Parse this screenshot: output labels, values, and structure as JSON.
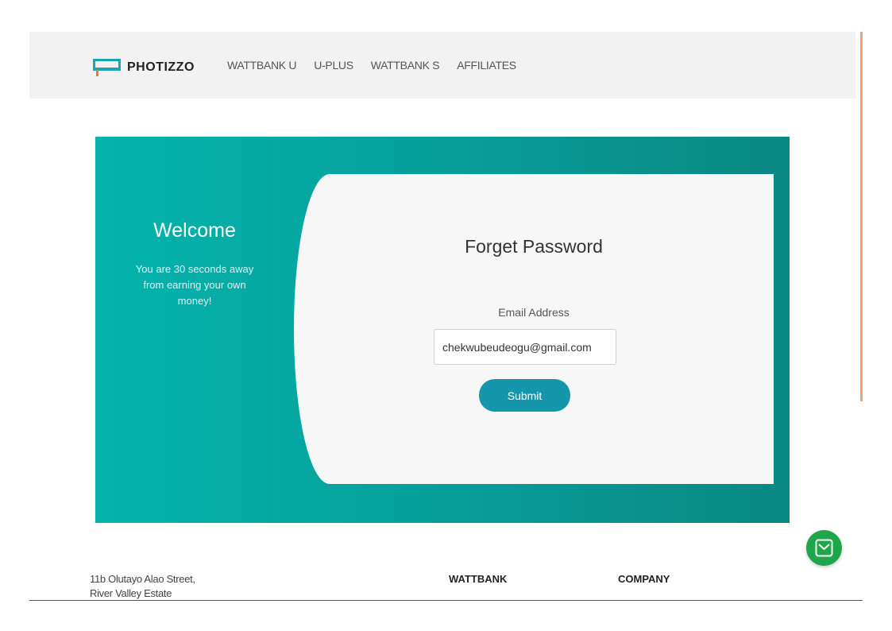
{
  "navbar": {
    "brand": "PHOTIZZO",
    "links": [
      "WATTBANK U",
      "U-PLUS",
      "WATTBANK S",
      "AFFILIATES"
    ]
  },
  "hero": {
    "welcome_title": "Welcome",
    "welcome_text": "You are 30 seconds away from earning your own money!"
  },
  "form": {
    "title": "Forget Password",
    "email_label": "Email Address",
    "email_value": "chekwubeudeogu@gmail.com",
    "submit_label": "Submit"
  },
  "footer": {
    "address_line1": "11b Olutayo Alao Street,",
    "address_line2": "River Valley Estate",
    "col1_heading": "WATTBANK",
    "col2_heading": "COMPANY"
  },
  "colors": {
    "teal": "#04b4ad",
    "button": "#1497ab",
    "fab": "#1fa64a"
  },
  "icons": {
    "fab": "mail-icon"
  }
}
